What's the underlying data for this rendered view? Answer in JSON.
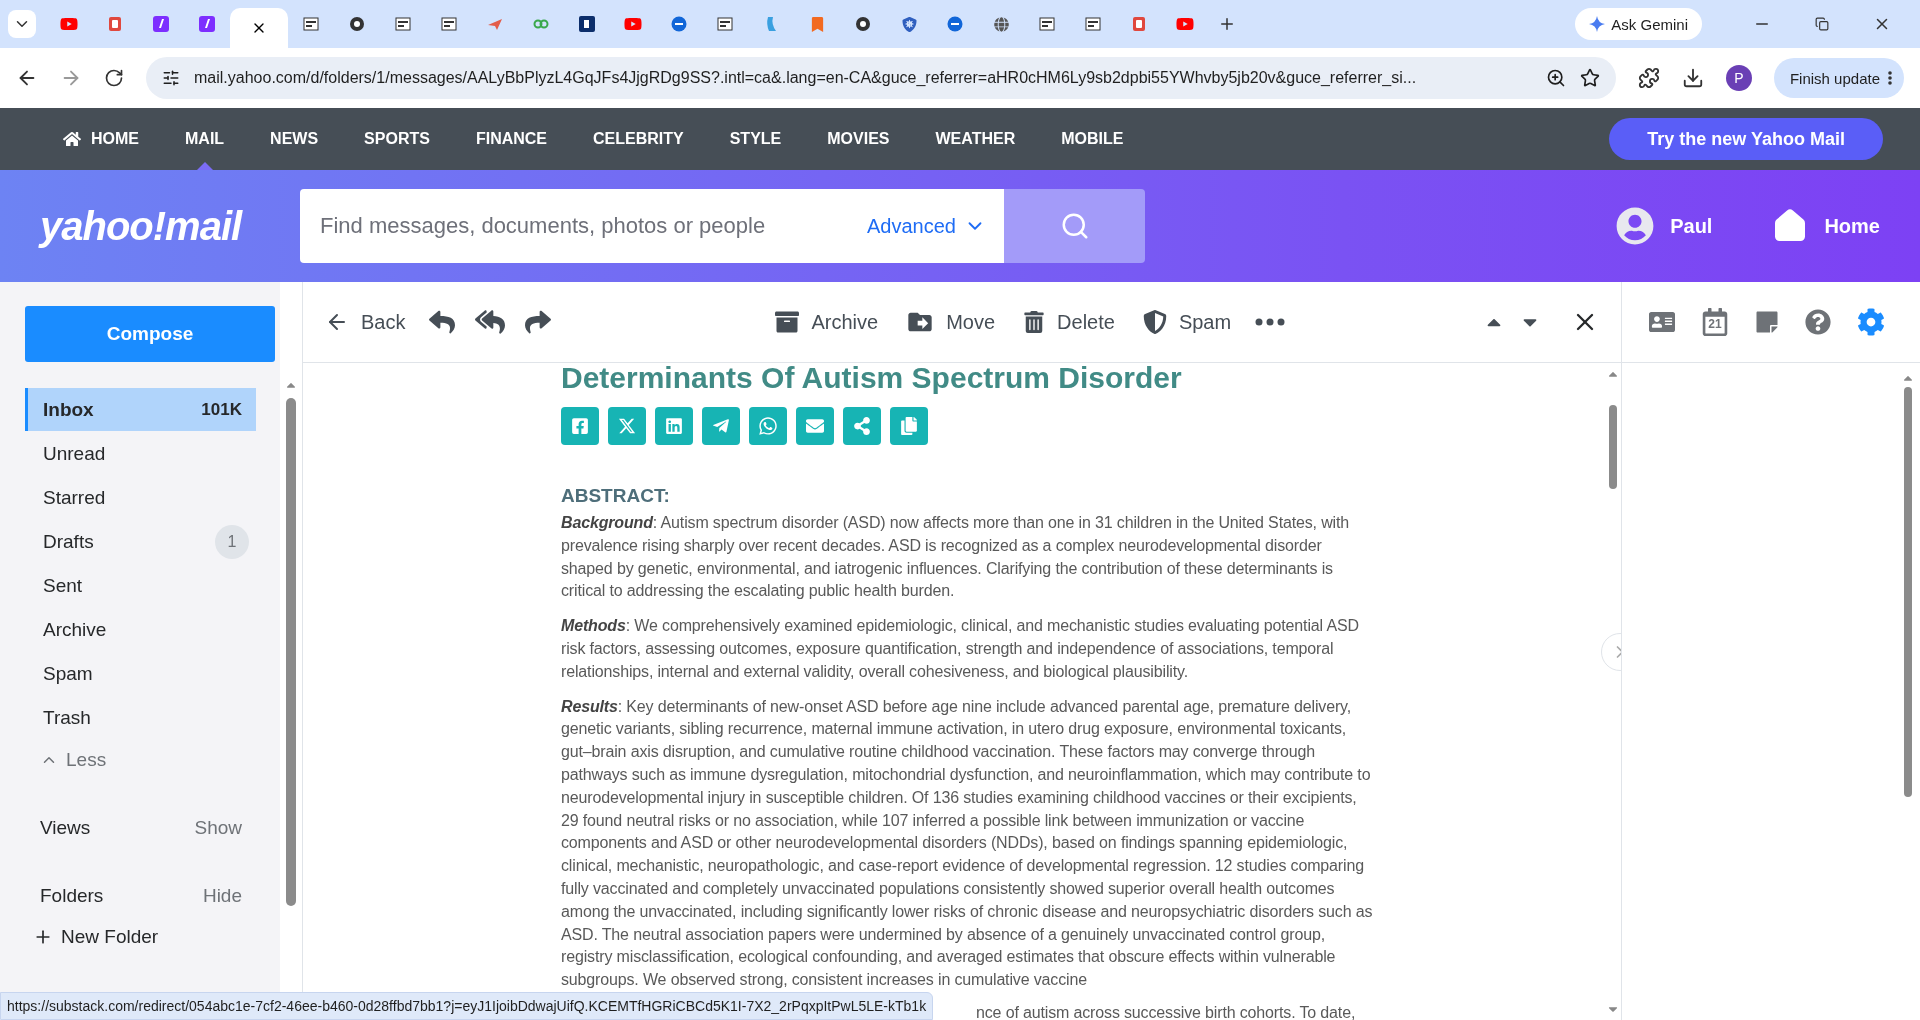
{
  "browser": {
    "tabs": [
      {
        "kind": "video",
        "selected": false
      },
      {
        "kind": "doc",
        "selected": false
      },
      {
        "kind": "yahoo",
        "selected": false
      },
      {
        "kind": "yahoo",
        "selected": false
      },
      {
        "kind": "blank",
        "selected": true
      },
      {
        "kind": "square",
        "selected": false
      },
      {
        "kind": "dark",
        "selected": false
      },
      {
        "kind": "square",
        "selected": false
      },
      {
        "kind": "square",
        "selected": false
      },
      {
        "kind": "bird",
        "selected": false
      },
      {
        "kind": "green",
        "selected": false
      },
      {
        "kind": "navy",
        "selected": false
      },
      {
        "kind": "video",
        "selected": false
      },
      {
        "kind": "circle",
        "selected": false
      },
      {
        "kind": "square",
        "selected": false
      },
      {
        "kind": "wave",
        "selected": false
      },
      {
        "kind": "bookmark",
        "selected": false
      },
      {
        "kind": "dark",
        "selected": false
      },
      {
        "kind": "shield",
        "selected": false
      },
      {
        "kind": "circle",
        "selected": false
      },
      {
        "kind": "globe",
        "selected": false
      },
      {
        "kind": "square",
        "selected": false
      },
      {
        "kind": "square",
        "selected": false
      },
      {
        "kind": "doc",
        "selected": false
      },
      {
        "kind": "video",
        "selected": false
      }
    ],
    "ask": "Ask Gemini",
    "url": "mail.yahoo.com/d/folders/1/messages/AALyBbPlyzL4GqJFs4JjgRDg9SS?.intl=ca&.lang=en-CA&guce_referrer=aHR0cHM6Ly9sb2dpbi55YWhvby5jb20v&guce_referrer_si...",
    "profile": "P",
    "update": "Finish update"
  },
  "nav": {
    "items": [
      {
        "label": "HOME",
        "selected": false
      },
      {
        "label": "MAIL",
        "selected": true
      },
      {
        "label": "NEWS",
        "selected": false
      },
      {
        "label": "SPORTS",
        "selected": false
      },
      {
        "label": "FINANCE",
        "selected": false
      },
      {
        "label": "CELEBRITY",
        "selected": false
      },
      {
        "label": "STYLE",
        "selected": false
      },
      {
        "label": "MOVIES",
        "selected": false
      },
      {
        "label": "WEATHER",
        "selected": false
      },
      {
        "label": "MOBILE",
        "selected": false
      }
    ],
    "try": "Try the new Yahoo Mail"
  },
  "header": {
    "logo": "yahoo!mail",
    "placeholder": "Find messages, documents, photos or people",
    "advanced": "Advanced",
    "user": "Paul",
    "home": "Home"
  },
  "sidebar": {
    "compose": "Compose",
    "folders": [
      {
        "label": "Inbox",
        "count": "101K",
        "selected": true
      },
      {
        "label": "Unread",
        "selected": false
      },
      {
        "label": "Starred",
        "selected": false
      },
      {
        "label": "Drafts",
        "count": "1",
        "selected": false
      },
      {
        "label": "Sent",
        "selected": false
      },
      {
        "label": "Archive",
        "selected": false
      },
      {
        "label": "Spam",
        "selected": false
      },
      {
        "label": "Trash",
        "selected": false
      }
    ],
    "less": "Less",
    "sections": [
      {
        "label": "Views",
        "action": "Show"
      },
      {
        "label": "Folders",
        "action": "Hide"
      }
    ],
    "new_folder": "New Folder"
  },
  "toolbar": {
    "back": "Back",
    "actions": [
      {
        "kind": "archive",
        "label": "Archive"
      },
      {
        "kind": "move",
        "label": "Move"
      },
      {
        "kind": "delete",
        "label": "Delete"
      },
      {
        "kind": "spam",
        "label": "Spam"
      }
    ]
  },
  "rail": {
    "calendar_day": "21"
  },
  "email": {
    "title": "Determinants Of Autism Spectrum Disorder",
    "share": [
      {
        "kind": "facebook"
      },
      {
        "kind": "x"
      },
      {
        "kind": "linkedin"
      },
      {
        "kind": "telegram"
      },
      {
        "kind": "whatsapp"
      },
      {
        "kind": "mail"
      },
      {
        "kind": "share"
      },
      {
        "kind": "copy"
      }
    ],
    "heading": "ABSTRACT:",
    "paragraphs": [
      {
        "label": "Background",
        "text": ": Autism spectrum disorder (ASD) now affects more than one in 31 children in the United States, with prevalence rising sharply over recent decades. ASD is recognized as a complex neurodevelopmental disorder shaped by genetic, environmental, and iatrogenic influences. Clarifying the contribution of these determinants is critical to addressing the escalating public health burden."
      },
      {
        "label": "Methods",
        "text": ": We comprehensively examined epidemiologic, clinical, and mechanistic studies evaluating potential ASD risk factors, assessing outcomes, exposure quantification, strength and independence of associations, temporal relationships, internal and external validity, overall cohesiveness, and biological plausibility."
      },
      {
        "label": "Results",
        "text": ": Key determinants of new-onset ASD before age nine include advanced parental age, premature delivery, genetic variants, sibling recurrence, maternal immune activation, in utero drug exposure, environmental toxicants, gut–brain axis disruption, and cumulative routine childhood vaccination. These factors may converge through pathways such as immune dysregulation, mitochondrial dysfunction, and neuroinflammation, which may contribute to neurodevelopmental injury in susceptible children. Of 136 studies examining childhood vaccines or their excipients, 29 found neutral risks or no association, while 107 inferred a possible link between immunization or vaccine components and ASD or other neurodevelopmental disorders (NDDs), based on findings spanning epidemiologic, clinical, mechanistic, neuropathologic, and case-report evidence of developmental regression. 12 studies comparing fully vaccinated and completely unvaccinated populations consistently showed superior overall health outcomes among the unvaccinated, including significantly lower risks of chronic disease and neuropsychiatric disorders such as ASD. The neutral association papers were undermined by absence of a genuinely unvaccinated control group, registry misclassification, ecological confounding, and averaged estimates that obscure effects within vulnerable subgroups. We observed strong, consistent increases in cumulative vaccine"
      }
    ],
    "tail": "nce of autism across successive birth cohorts. To date,"
  },
  "status_url": "https://substack.com/redirect/054abc1e-7cf2-46ee-b460-0d28ffbd7bb1?j=eyJ1IjoibDdwajUifQ.KCEMTfHGRiCBCd5K1I-7X2_2rPqxpItPwL5LE-kTb1k"
}
